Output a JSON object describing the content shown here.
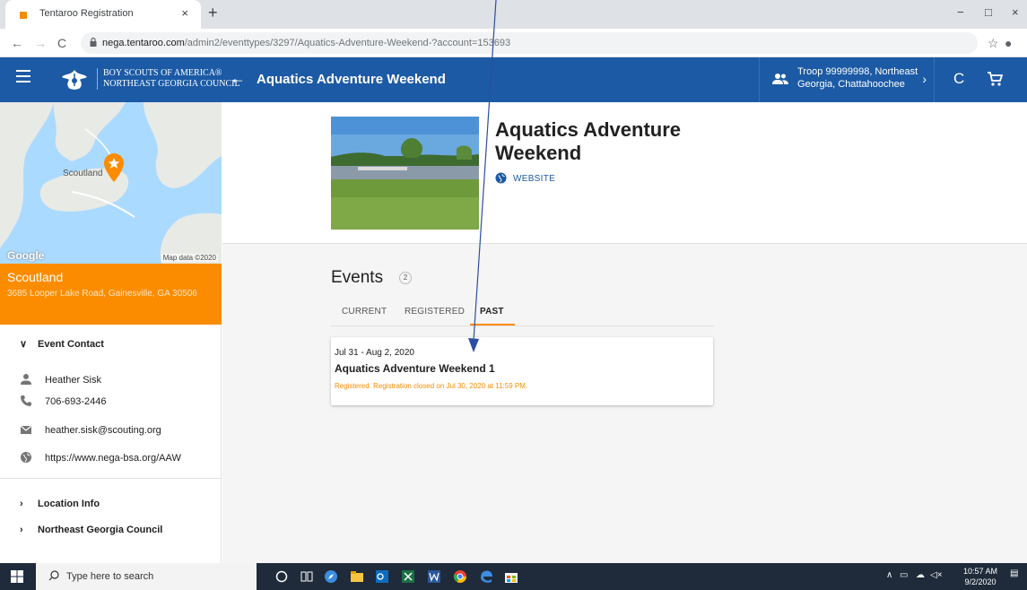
{
  "browser": {
    "tab_title": "Tentaroo Registration",
    "tab_close": "×",
    "new_tab": "+",
    "url_domain": "nega.tentaroo.com",
    "url_path": "/admin2/eventtypes/3297/Aquatics-Adventure-Weekend-?account=153693",
    "back": "←",
    "forward": "→",
    "reload": "C",
    "win_min": "−",
    "win_max": "□",
    "win_close": "×"
  },
  "header": {
    "org_line1": "BOY SCOUTS OF AMERICA®",
    "org_line2": "NORTHEAST GEORGIA COUNCIL",
    "title": "Aquatics Adventure Weekend",
    "troop_line1": "Troop 99999998, Northeast",
    "troop_line2": "Georgia, Chattahoochee",
    "back_glyph": "←",
    "chevron_glyph": "›",
    "refresh_glyph": "C"
  },
  "sidebar": {
    "map_label": "Scoutland",
    "google": "Google",
    "map_credit": "Map data ©2020",
    "location_name": "Scoutland",
    "location_address": "3685 Looper Lake Road, Gainesville, GA 30506",
    "event_contact_heading": "Event Contact",
    "contact_name": "Heather Sisk",
    "contact_phone": "706-693-2446",
    "contact_email": "heather.sisk@scouting.org",
    "contact_url": "https://www.nega-bsa.org/AAW",
    "location_info_heading": "Location Info",
    "council_heading": "Northeast Georgia Council",
    "chev_down": "∨",
    "chev_right": "›"
  },
  "main": {
    "event_title": "Aquatics Adventure Weekend",
    "website_label": "WEBSITE",
    "events_heading": "Events",
    "events_count": "2",
    "tabs": [
      {
        "label": "CURRENT"
      },
      {
        "label": "REGISTERED"
      },
      {
        "label": "PAST"
      }
    ],
    "card": {
      "date": "Jul 31 - Aug 2, 2020",
      "name": "Aquatics Adventure Weekend 1",
      "status": "Registered. Registration closed on Jul 30, 2020 at 11:59 PM."
    }
  },
  "taskbar": {
    "search_placeholder": "Type here to search",
    "time": "10:57 AM",
    "date": "9/2/2020"
  },
  "colors": {
    "brand_blue": "#1c5aa5",
    "accent_orange": "#fb8c00",
    "annotation_arrow": "#2b4ea0"
  }
}
